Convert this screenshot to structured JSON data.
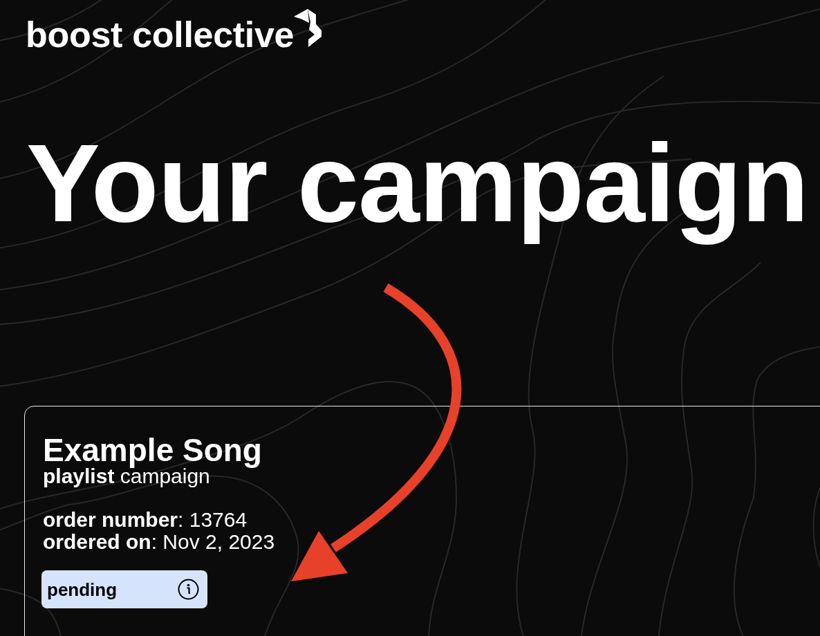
{
  "brand": {
    "name": "boost collective"
  },
  "page_title": "Your campaign",
  "campaigns": [
    {
      "title": "Example Song",
      "subtitle": "**playlist** campaign",
      "details": [
        "**order number**: 13764",
        "**ordered on**: Nov 2, 2023"
      ],
      "status": "pending"
    }
  ],
  "annotation": {
    "kind": "curved-arrow"
  }
}
